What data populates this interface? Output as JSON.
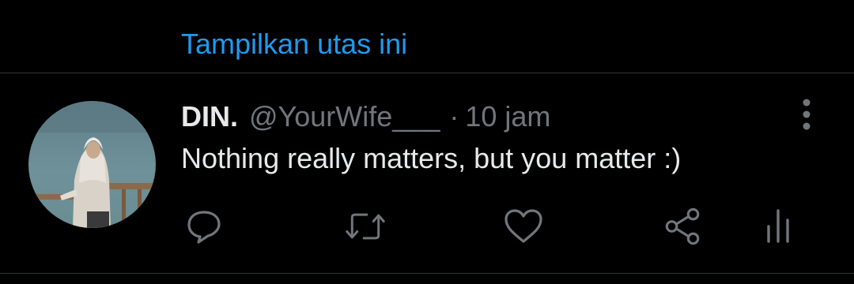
{
  "thread": {
    "show_thread_label": "Tampilkan utas ini"
  },
  "tweet": {
    "display_name": "DIN.",
    "handle": "@YourWife___",
    "separator": "·",
    "timestamp": "10 jam",
    "text": "Nothing really matters, but you matter :)"
  },
  "actions": [
    {
      "name": "reply",
      "icon": "speech-bubble-icon"
    },
    {
      "name": "retweet",
      "icon": "retweet-arrows-icon"
    },
    {
      "name": "like",
      "icon": "heart-icon"
    },
    {
      "name": "share",
      "icon": "share-nodes-icon"
    },
    {
      "name": "analytics",
      "icon": "bar-chart-icon"
    }
  ],
  "colors": {
    "background": "#000000",
    "link": "#1d9bf0",
    "primary_text": "#e7e9ea",
    "secondary_text": "#71767b",
    "divider": "#2f3336"
  }
}
